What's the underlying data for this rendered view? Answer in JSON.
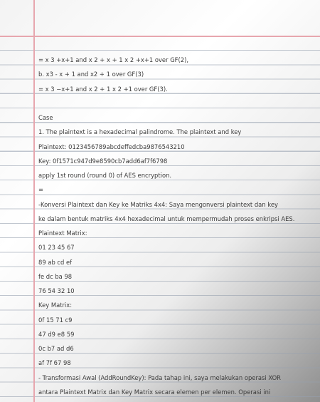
{
  "lines": [
    "= x 3 +x+1 and x 2 + x + 1 x 2 +x+1 over GF(2),",
    "b. x3 - x + 1 and x2 + 1 over GF(3)",
    "= x 3 −x+1 and x 2 + 1 x 2 +1 over GF(3).",
    "",
    "Case",
    "1. The plaintext is a hexadecimal palindrome. The plaintext and key",
    "Plaintext: 0123456789abcdeffedcba9876543210",
    "Key: 0f1571c947d9e8590cb7add6af7f6798",
    "apply 1st round (round 0) of AES encryption.",
    "=",
    "-Konversi Plaintext dan Key ke Matriks 4x4: Saya mengonversi plaintext dan key",
    "ke dalam bentuk matriks 4x4 hexadecimal untuk mempermudah proses enkripsi AES.",
    "Plaintext Matrix:",
    "01 23 45 67",
    "89 ab cd ef",
    "fe dc ba 98",
    "76 54 32 10",
    "Key Matrix:",
    "0f 15 71 c9",
    "47 d9 e8 59",
    "0c b7 ad d6",
    "af 7f 67 98",
    "- Transformasi Awal (AddRoundKey): Pada tahap ini, saya melakukan operasi XOR",
    "antara Plaintext Matrix dan Key Matrix secara elemen per elemen. Operasi ini"
  ]
}
